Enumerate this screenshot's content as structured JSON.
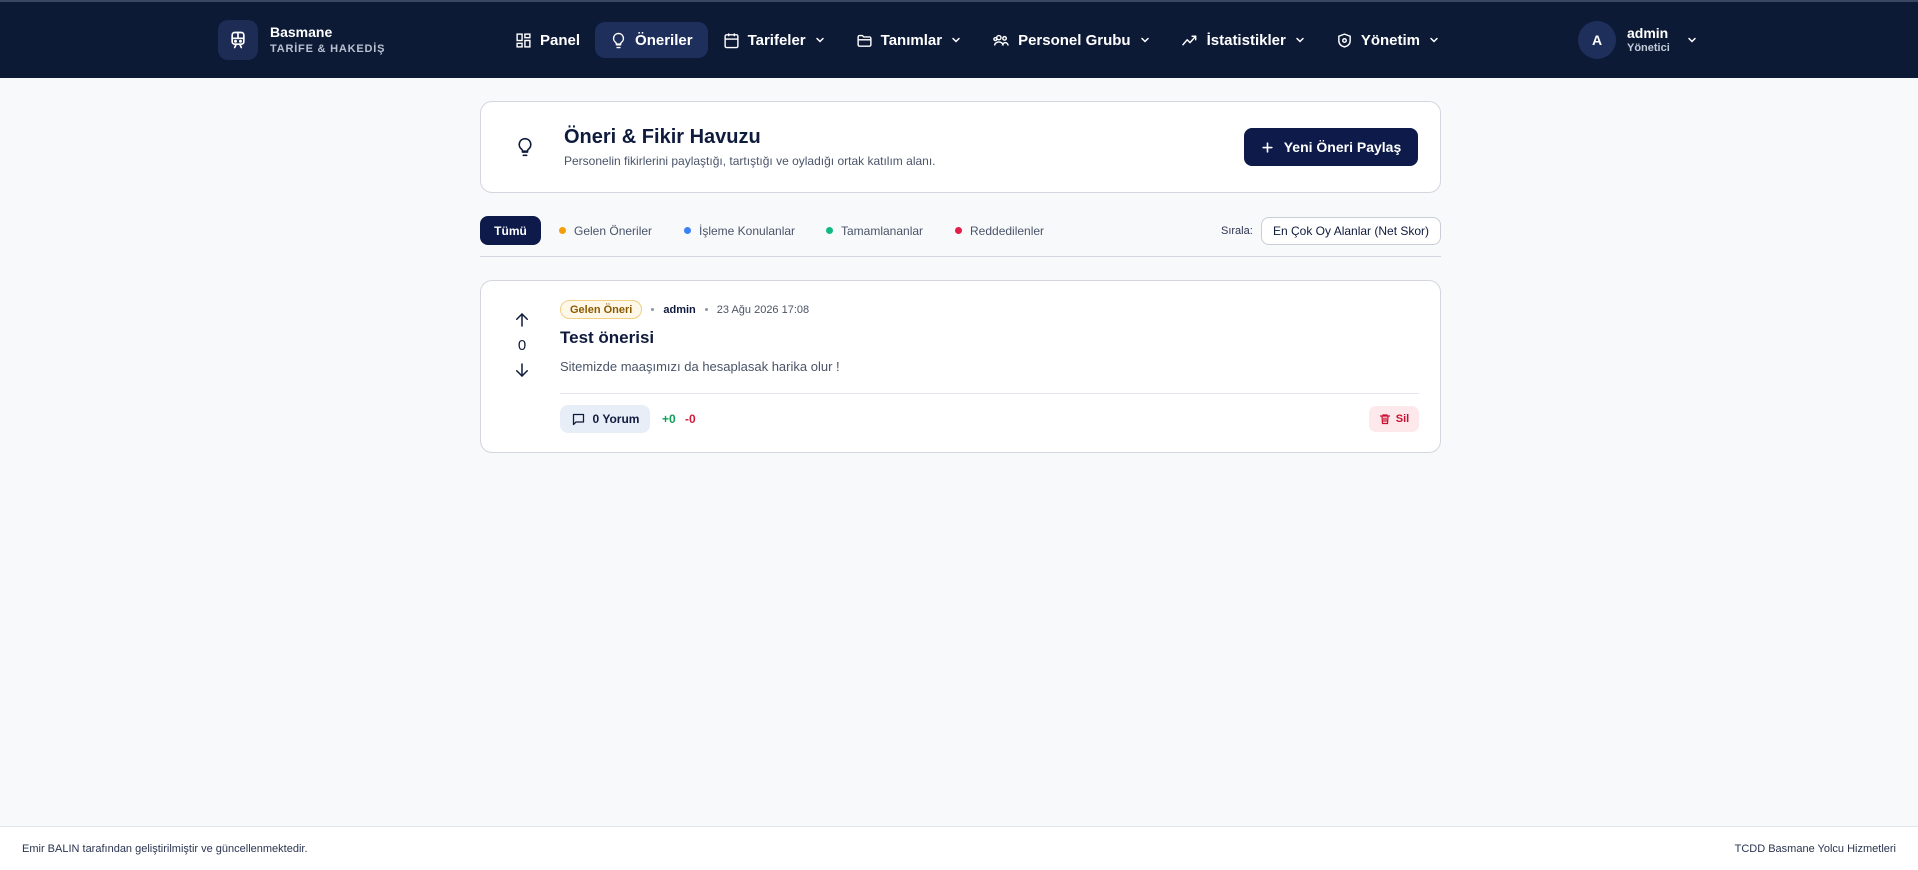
{
  "brand": {
    "name": "Basmane",
    "subtitle": "TARİFE & HAKEDİŞ",
    "logo_icon": "train-icon"
  },
  "nav": {
    "items": [
      {
        "label": "Panel",
        "icon": "dashboard-icon",
        "dropdown": false,
        "active": false
      },
      {
        "label": "Öneriler",
        "icon": "lightbulb-icon",
        "dropdown": false,
        "active": true
      },
      {
        "label": "Tarifeler",
        "icon": "calendar-icon",
        "dropdown": true,
        "active": false
      },
      {
        "label": "Tanımlar",
        "icon": "folder-icon",
        "dropdown": true,
        "active": false
      },
      {
        "label": "Personel Grubu",
        "icon": "users-icon",
        "dropdown": true,
        "active": false
      },
      {
        "label": "İstatistikler",
        "icon": "trend-icon",
        "dropdown": true,
        "active": false
      },
      {
        "label": "Yönetim",
        "icon": "settings-icon",
        "dropdown": true,
        "active": false
      }
    ]
  },
  "user": {
    "initial": "A",
    "name": "admin",
    "role": "Yönetici"
  },
  "page_header": {
    "title": "Öneri & Fikir Havuzu",
    "description": "Personelin fikirlerini paylaştığı, tartıştığı ve oyladığı ortak katılım alanı.",
    "new_button": "Yeni Öneri Paylaş"
  },
  "filters": {
    "all_label": "Tümü",
    "tabs": [
      {
        "label": "Gelen Öneriler",
        "color": "#f59e0b"
      },
      {
        "label": "İşleme Konulanlar",
        "color": "#3b82f6"
      },
      {
        "label": "Tamamlananlar",
        "color": "#10b981"
      },
      {
        "label": "Reddedilenler",
        "color": "#e11d48"
      }
    ],
    "sort_label": "Sırala:",
    "sort_value": "En Çok Oy Alanlar (Net Skor)"
  },
  "idea": {
    "vote_count": "0",
    "status": "Gelen Öneri",
    "author": "admin",
    "date": "23 Ağu 2026 17:08",
    "title": "Test önerisi",
    "body": "Sitemizde maaşımızı da hesaplasak harika olur !",
    "comments": "0 Yorum",
    "upvotes": "+0",
    "downvotes": "-0",
    "delete_label": "Sil"
  },
  "footer": {
    "left": "Emir BALIN tarafından geliştirilmiştir ve güncellenmektedir.",
    "right": "TCDD Basmane Yolcu Hizmetleri"
  }
}
